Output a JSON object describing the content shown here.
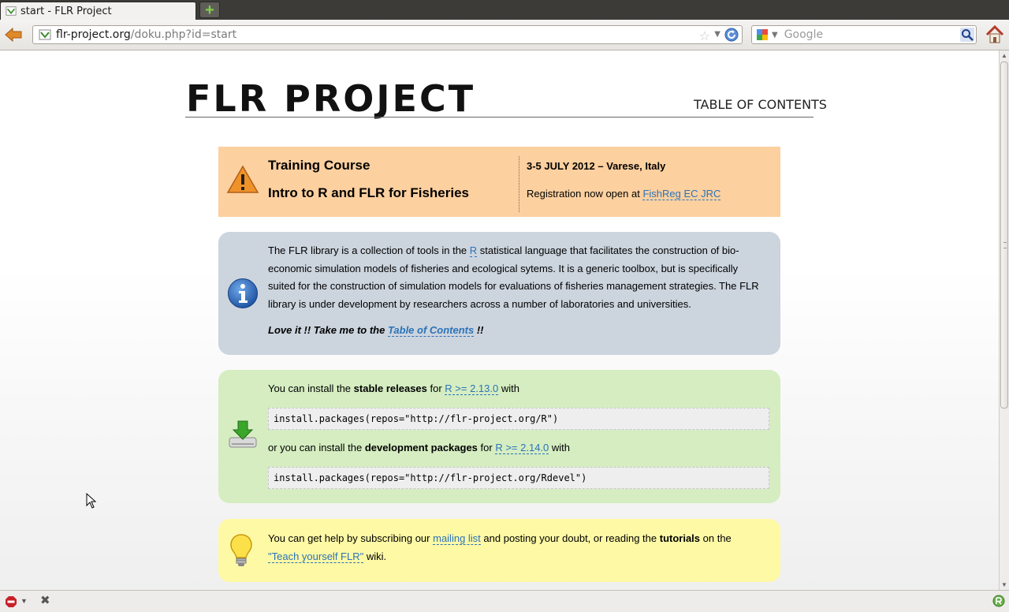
{
  "browser": {
    "tab_title": "start - FLR Project",
    "new_tab_symbol": "+",
    "url_host": "flr-project.org",
    "url_path": "/doku.php?id=start",
    "search_placeholder": "Google"
  },
  "site": {
    "title": "FLR PROJECT",
    "toc_link": "TABLE OF CONTENTS"
  },
  "training": {
    "title": "Training Course",
    "subtitle": "Intro to R and FLR for Fisheries",
    "date": "3-5 JULY 2012 – Varese, Italy",
    "registration_prefix": "Registration now open at ",
    "registration_link": "FishReg EC JRC"
  },
  "info": {
    "text_before_link": "The FLR library is a collection of tools in the ",
    "r_link": "R",
    "text_after_link": " statistical language that facilitates the construction of bio-economic simulation models of fisheries and ecological sytems. It is a generic toolbox, but is specifically suited for the construction of simulation models for evaluations of fisheries management strategies. The FLR library is under development by researchers across a number of laboratories and universities.",
    "love_prefix": "Love it !! Take me to the ",
    "love_link": "Table of Contents",
    "love_suffix": " !!"
  },
  "install": {
    "line1_prefix": "You can install the ",
    "line1_bold": "stable releases",
    "line1_mid": " for ",
    "line1_link": "R >= 2.13.0",
    "line1_suffix": " with",
    "code1": "install.packages(repos=\"http://flr-project.org/R\")",
    "line2_prefix": "or you can install the ",
    "line2_bold": "development packages",
    "line2_mid": " for ",
    "line2_link": "R >= 2.14.0",
    "line2_suffix": " with",
    "code2": "install.packages(repos=\"http://flr-project.org/Rdevel\")"
  },
  "help": {
    "prefix": "You can get help by subscribing our ",
    "mailing_link": "mailing list",
    "mid": " and posting your doubt, or reading the ",
    "bold": "tutorials",
    "mid2": " on the ",
    "wiki_link": "\"Teach yourself FLR\"",
    "suffix": " wiki."
  },
  "statusbar": {
    "close_symbol": "✖"
  },
  "colors": {
    "link": "#2b73b7",
    "training_bg": "#fdd09f",
    "info_bg": "#ccd4de",
    "install_bg": "#d5edc1",
    "help_bg": "#fef9a5"
  }
}
